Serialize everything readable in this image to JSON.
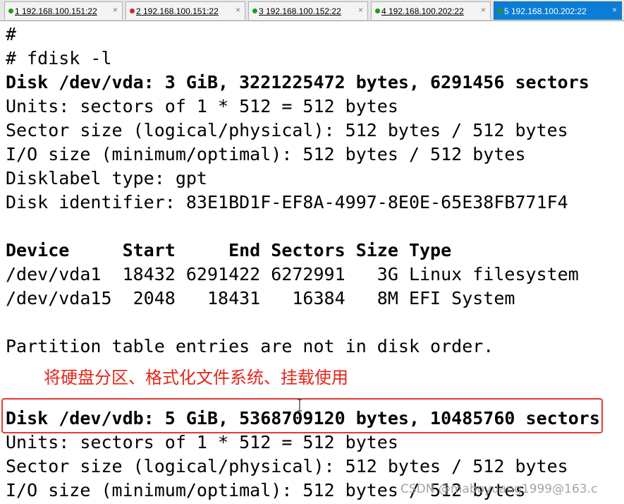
{
  "tabs": [
    {
      "label": "1 192.168.100.151:22",
      "status": "green",
      "active": false
    },
    {
      "label": "2 192.168.100.151:22",
      "status": "red",
      "active": false
    },
    {
      "label": "3 192.168.100.152:22",
      "status": "green",
      "active": false
    },
    {
      "label": "4 192.168.100.202:22",
      "status": "green",
      "active": false
    },
    {
      "label": "5 192.168.100.202:22",
      "status": "green",
      "active": true
    }
  ],
  "tab_close_glyph": "×",
  "terminal": {
    "lines": [
      {
        "text": "#",
        "bold": false
      },
      {
        "text": "# fdisk -l",
        "bold": false
      },
      {
        "text": "Disk /dev/vda: 3 GiB, 3221225472 bytes, 6291456 sectors",
        "bold": true
      },
      {
        "text": "Units: sectors of 1 * 512 = 512 bytes",
        "bold": false
      },
      {
        "text": "Sector size (logical/physical): 512 bytes / 512 bytes",
        "bold": false
      },
      {
        "text": "I/O size (minimum/optimal): 512 bytes / 512 bytes",
        "bold": false
      },
      {
        "text": "Disklabel type: gpt",
        "bold": false
      },
      {
        "text": "Disk identifier: 83E1BD1F-EF8A-4997-8E0E-65E38FB771F4",
        "bold": false
      },
      {
        "text": "",
        "bold": false
      },
      {
        "text": "Device     Start     End Sectors Size Type",
        "bold": true
      },
      {
        "text": "/dev/vda1  18432 6291422 6272991   3G Linux filesystem",
        "bold": false
      },
      {
        "text": "/dev/vda15  2048   18431   16384   8M EFI System",
        "bold": false
      },
      {
        "text": "",
        "bold": false
      },
      {
        "text": "Partition table entries are not in disk order.",
        "bold": false
      },
      {
        "text": "",
        "bold": false
      },
      {
        "text": "Disk /dev/vdb: 5 GiB, 5368709120 bytes, 10485760 sectors",
        "bold": true
      },
      {
        "text": "Units: sectors of 1 * 512 = 512 bytes",
        "bold": false
      },
      {
        "text": "Sector size (logical/physical): 512 bytes / 512 bytes",
        "bold": false
      },
      {
        "text": "I/O size (minimum/optimal): 512 bytes / 512 bytes",
        "bold": false
      }
    ]
  },
  "annotation": "将硬盘分区、格式化文件系统、挂载使用",
  "watermark": "CSDN @maboyuang1999@163.c",
  "colors": {
    "active_tab": "#0b7dd6",
    "annotation": "#e0261b",
    "highlight_border": "#e53935",
    "status_green": "#1b9e1b",
    "status_red": "#e02020"
  }
}
